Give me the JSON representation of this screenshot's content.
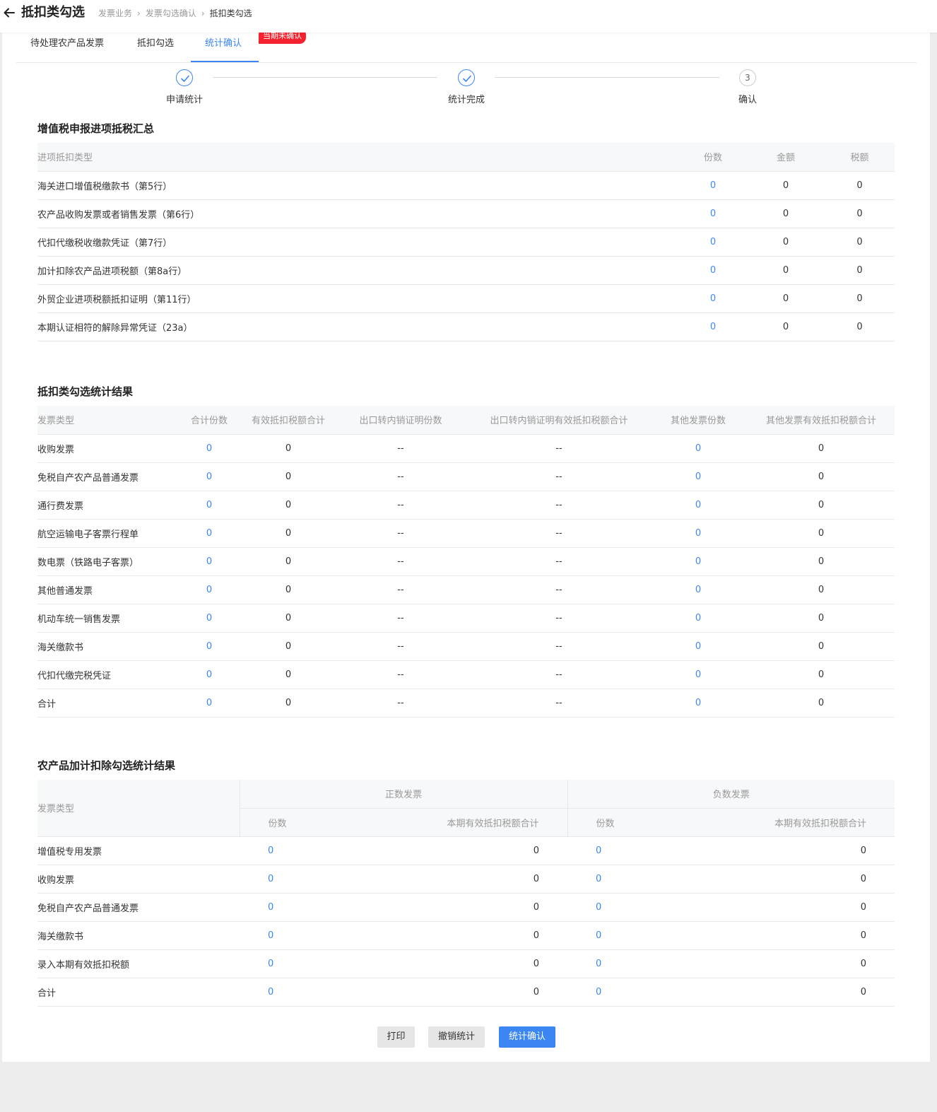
{
  "header": {
    "title": "抵扣类勾选",
    "breadcrumb": [
      "发票业务",
      "发票勾选确认",
      "抵扣类勾选"
    ]
  },
  "tabs": [
    {
      "label": "待处理农产品发票"
    },
    {
      "label": "抵扣勾选"
    },
    {
      "label": "统计确认",
      "active": true
    }
  ],
  "tab_badge": "当期未确认",
  "steps": [
    {
      "label": "申请统计",
      "status": "done"
    },
    {
      "label": "统计完成",
      "status": "done"
    },
    {
      "label": "确认",
      "status": "pending",
      "number": "3"
    }
  ],
  "section1": {
    "title": "增值税申报进项抵税汇总",
    "headers": [
      "进项抵扣类型",
      "份数",
      "金额",
      "税额"
    ],
    "rows": [
      [
        "海关进口增值税缴款书（第5行）",
        "0",
        "0",
        "0"
      ],
      [
        "农产品收购发票或者销售发票（第6行）",
        "0",
        "0",
        "0"
      ],
      [
        "代扣代缴税收缴款凭证（第7行）",
        "0",
        "0",
        "0"
      ],
      [
        "加计扣除农产品进项税额（第8a行）",
        "0",
        "0",
        "0"
      ],
      [
        "外贸企业进项税额抵扣证明（第11行）",
        "0",
        "0",
        "0"
      ],
      [
        "本期认证相符的解除异常凭证（23a）",
        "0",
        "0",
        "0"
      ]
    ]
  },
  "section2": {
    "title": "抵扣类勾选统计结果",
    "headers": [
      "发票类型",
      "合计份数",
      "有效抵扣税额合计",
      "出口转内销证明份数",
      "出口转内销证明有效抵扣税额合计",
      "其他发票份数",
      "其他发票有效抵扣税额合计"
    ],
    "rows": [
      [
        "收购发票",
        "0",
        "0",
        "--",
        "--",
        "0",
        "0"
      ],
      [
        "免税自产农产品普通发票",
        "0",
        "0",
        "--",
        "--",
        "0",
        "0"
      ],
      [
        "通行费发票",
        "0",
        "0",
        "--",
        "--",
        "0",
        "0"
      ],
      [
        "航空运输电子客票行程单",
        "0",
        "0",
        "--",
        "--",
        "0",
        "0"
      ],
      [
        "数电票（铁路电子客票）",
        "0",
        "0",
        "--",
        "--",
        "0",
        "0"
      ],
      [
        "其他普通发票",
        "0",
        "0",
        "--",
        "--",
        "0",
        "0"
      ],
      [
        "机动车统一销售发票",
        "0",
        "0",
        "--",
        "--",
        "0",
        "0"
      ],
      [
        "海关缴款书",
        "0",
        "0",
        "--",
        "--",
        "0",
        "0"
      ],
      [
        "代扣代缴完税凭证",
        "0",
        "0",
        "--",
        "--",
        "0",
        "0"
      ],
      [
        "合计",
        "0",
        "0",
        "--",
        "--",
        "0",
        "0"
      ]
    ]
  },
  "section3": {
    "title": "农产品加计扣除勾选统计结果",
    "header_type": "发票类型",
    "group_positive": "正数发票",
    "group_negative": "负数发票",
    "sub_headers": [
      "份数",
      "本期有效抵扣税额合计",
      "份数",
      "本期有效抵扣税额合计"
    ],
    "rows": [
      [
        "增值税专用发票",
        "0",
        "0",
        "0",
        "0"
      ],
      [
        "收购发票",
        "0",
        "0",
        "0",
        "0"
      ],
      [
        "免税自产农产品普通发票",
        "0",
        "0",
        "0",
        "0"
      ],
      [
        "海关缴款书",
        "0",
        "0",
        "0",
        "0"
      ],
      [
        "录入本期有效抵扣税额",
        "0",
        "0",
        "0",
        "0"
      ],
      [
        "合计",
        "0",
        "0",
        "0",
        "0"
      ]
    ]
  },
  "buttons": {
    "print": "打印",
    "revoke": "撤销统计",
    "confirm": "统计确认"
  },
  "colors": {
    "primary": "#3b86f3",
    "badge": "#f5222d",
    "page_bg": "#ededed",
    "header_bg": "#f7f8fa"
  }
}
